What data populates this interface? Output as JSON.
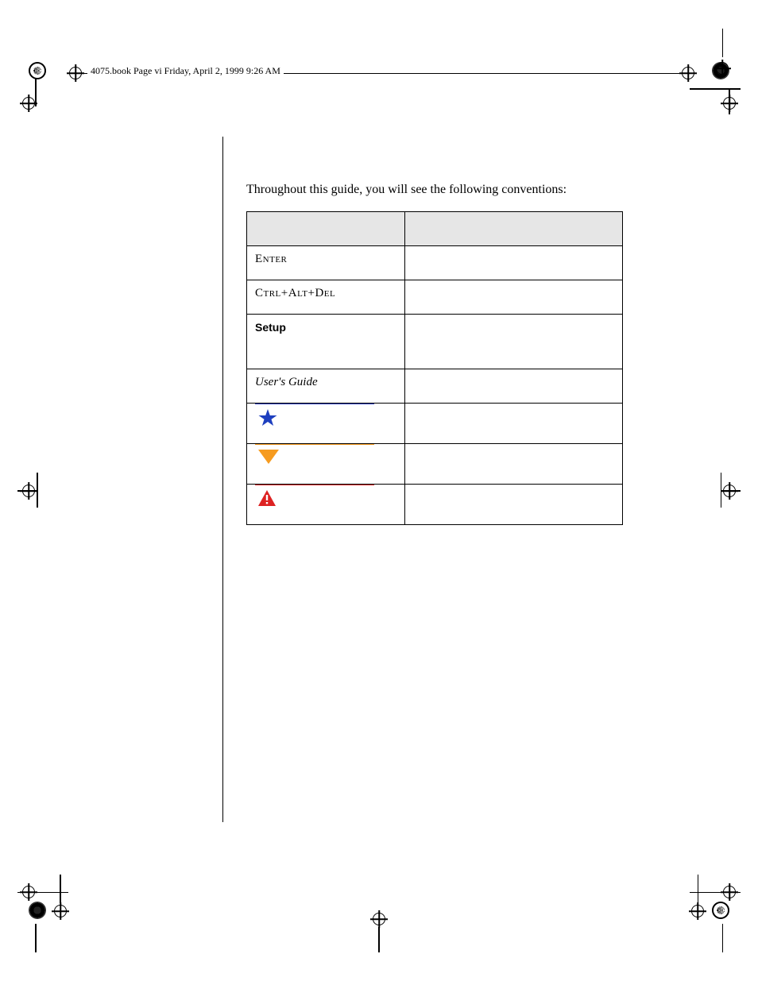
{
  "header": {
    "running_head": "4075.book  Page vi  Friday, April 2, 1999  9:26 AM"
  },
  "content": {
    "intro": "Throughout this guide, you will see the following conventions:",
    "table": {
      "header": [
        "",
        ""
      ],
      "rows": [
        {
          "a": "Enter",
          "a_class": "smallcaps",
          "b": ""
        },
        {
          "a": "Ctrl+Alt+Del",
          "a_class": "smallcaps",
          "b": ""
        },
        {
          "a": "Setup",
          "a_class": "helv-bold",
          "b": "",
          "tall": true
        },
        {
          "a": "User's Guide",
          "a_class": "ital",
          "b": ""
        },
        {
          "icon": "star",
          "rule": "blue",
          "b": ""
        },
        {
          "icon": "caution-triangle",
          "rule": "orange",
          "b": ""
        },
        {
          "icon": "warning-triangle",
          "rule": "red",
          "b": ""
        }
      ]
    }
  }
}
